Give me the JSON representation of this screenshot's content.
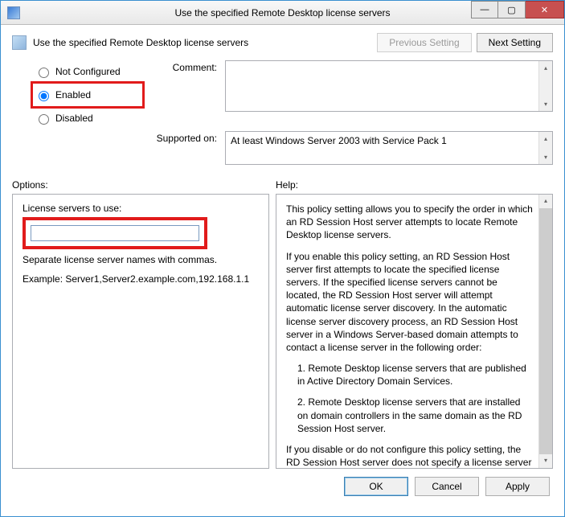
{
  "window": {
    "title": "Use the specified Remote Desktop license servers"
  },
  "header": {
    "subtitle": "Use the specified Remote Desktop license servers",
    "prev_label": "Previous Setting",
    "next_label": "Next Setting"
  },
  "state": {
    "not_configured_label": "Not Configured",
    "enabled_label": "Enabled",
    "disabled_label": "Disabled",
    "selected": "enabled"
  },
  "comment": {
    "label": "Comment:",
    "value": ""
  },
  "supported": {
    "label": "Supported on:",
    "value": "At least Windows Server 2003 with Service Pack 1"
  },
  "options": {
    "section_label": "Options:",
    "license_label": "License servers to use:",
    "license_value": "",
    "hint1": "Separate license server names with commas.",
    "hint2": "Example: Server1,Server2.example.com,192.168.1.1"
  },
  "help": {
    "section_label": "Help:",
    "p1": "This policy setting allows you to specify the order in which an RD Session Host server attempts to locate Remote Desktop license servers.",
    "p2": "If you enable this policy setting, an RD Session Host server first attempts to locate the specified license servers. If the specified license servers cannot be located, the RD Session Host server will attempt automatic license server discovery. In the automatic license server discovery process, an RD Session Host server in a Windows Server-based domain attempts to contact a license server in the following order:",
    "p3": "1. Remote Desktop license servers that are published in Active Directory Domain Services.",
    "p4": "2. Remote Desktop license servers that are installed on domain controllers in the same domain as the RD Session Host server.",
    "p5": "If you disable or do not configure this policy setting, the RD Session Host server does not specify a license server at the Group Policy level."
  },
  "footer": {
    "ok": "OK",
    "cancel": "Cancel",
    "apply": "Apply"
  }
}
